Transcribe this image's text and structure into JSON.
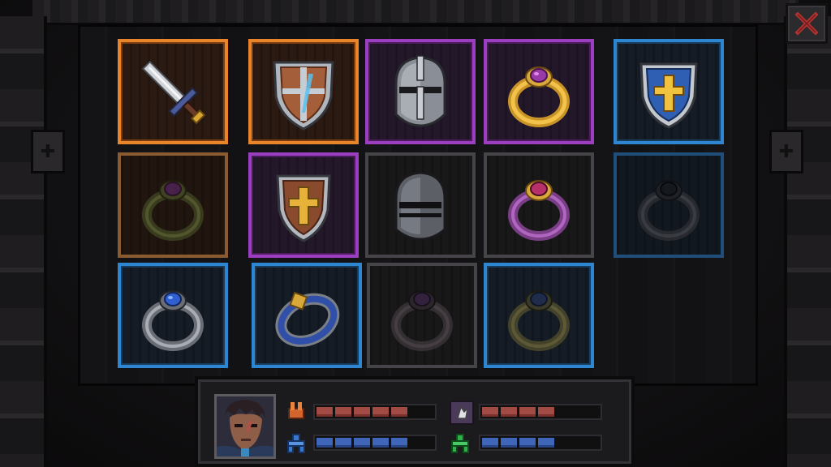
{
  "window": {
    "close_icon": "close-x-icon",
    "accent_close": "#b43232"
  },
  "inventory": {
    "rarity_colors": {
      "legendary": "#e8842a",
      "epic": "#9c3ec0",
      "rare": "#2f86d0",
      "common": "#464448"
    },
    "slots": [
      {
        "item": "sword-icon",
        "rarity": "legendary"
      },
      {
        "item": "wooden-shield-icon",
        "rarity": "legendary"
      },
      {
        "item": "knight-helmet-icon",
        "rarity": "epic"
      },
      {
        "item": "gold-ring-icon",
        "rarity": "epic"
      },
      {
        "item": "blue-cross-shield-icon",
        "rarity": "rare"
      },
      {
        "item": "green-ring-icon",
        "rarity": "legendary-dim"
      },
      {
        "item": "gold-cross-shield-icon",
        "rarity": "epic"
      },
      {
        "item": "iron-helmet-icon",
        "rarity": "common"
      },
      {
        "item": "purple-ring-icon",
        "rarity": "common"
      },
      {
        "item": "black-ring-icon",
        "rarity": "rare-dim"
      },
      {
        "item": "silver-ring-icon",
        "rarity": "rare"
      },
      {
        "item": "sapphire-ring-icon",
        "rarity": "rare"
      },
      {
        "item": "dark-ring-icon",
        "rarity": "common"
      },
      {
        "item": "olive-ring-icon",
        "rarity": "rare"
      }
    ]
  },
  "character": {
    "portrait_icon": "hero-portrait-icon",
    "stats": [
      {
        "icon": "attack-icon",
        "color": "#d2642e",
        "bar_color": "red",
        "filled_segments": 5,
        "max_segments": 7
      },
      {
        "icon": "magic-attack-icon",
        "color": "#9c3ec0",
        "bar_color": "red",
        "filled_segments": 4,
        "max_segments": 7
      },
      {
        "icon": "defense-icon",
        "color": "#3a78d0",
        "bar_color": "blue",
        "filled_segments": 5,
        "max_segments": 7
      },
      {
        "icon": "magic-defense-icon",
        "color": "#2fae4a",
        "bar_color": "blue",
        "filled_segments": 4,
        "max_segments": 7
      }
    ]
  }
}
